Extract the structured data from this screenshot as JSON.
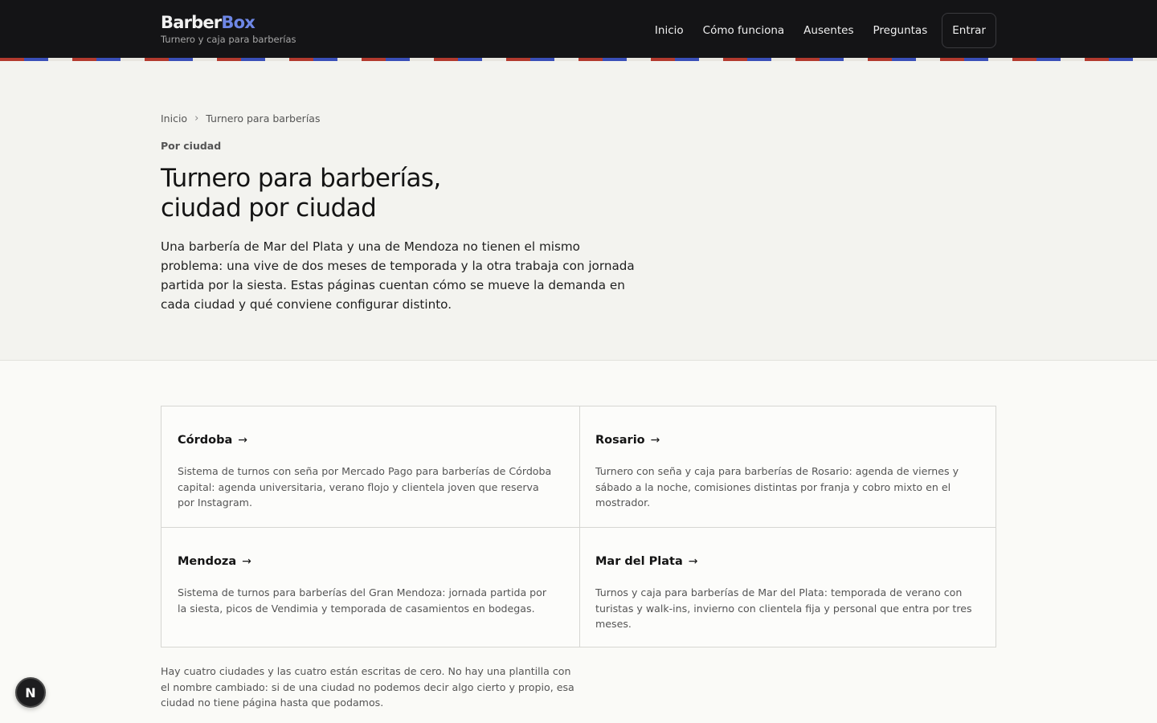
{
  "header": {
    "brand_part1": "Barber",
    "brand_part2": "Box",
    "tagline": "Turnero y caja para barberías",
    "nav": [
      "Inicio",
      "Cómo funciona",
      "Ausentes",
      "Preguntas"
    ],
    "login_label": "Entrar"
  },
  "breadcrumb": {
    "home": "Inicio",
    "separator": "›",
    "current": "Turnero para barberías"
  },
  "hero": {
    "eyebrow": "Por ciudad",
    "title_line1": "Turnero para barberías,",
    "title_line2": "ciudad por ciudad",
    "lead": "Una barbería de Mar del Plata y una de Mendoza no tienen el mismo problema: una vive de dos meses de temporada y la otra trabaja con jornada partida por la siesta. Estas páginas cuentan cómo se mueve la demanda en cada ciudad y qué conviene configurar distinto."
  },
  "cities": [
    {
      "name": "Córdoba",
      "arrow": "→",
      "description": "Sistema de turnos con seña por Mercado Pago para barberías de Córdoba capital: agenda universitaria, verano flojo y clientela joven que reserva por Instagram."
    },
    {
      "name": "Rosario",
      "arrow": "→",
      "description": "Turnero con seña y caja para barberías de Rosario: agenda de viernes y sábado a la noche, comisiones distintas por franja y cobro mixto en el mostrador."
    },
    {
      "name": "Mendoza",
      "arrow": "→",
      "description": "Sistema de turnos para barberías del Gran Mendoza: jornada partida por la siesta, picos de Vendimia y temporada de casamientos en bodegas."
    },
    {
      "name": "Mar del Plata",
      "arrow": "→",
      "description": "Turnos y caja para barberías de Mar del Plata: temporada de verano con turistas y walk-ins, invierno con clientela fija y personal que entra por tres meses."
    }
  ],
  "footnote": "Hay cuatro ciudades y las cuatro están escritas de cero. No hay una plantilla con el nombre cambiado: si de una ciudad no podemos decir algo cierto y propio, esa ciudad no tiene página hasta que podamos.",
  "fab": {
    "label": "N"
  },
  "colors": {
    "header_bg": "#141416",
    "brand_accent": "#6e87e6",
    "pole_red": "#b33a2e",
    "pole_blue": "#3a4fb8",
    "pole_white": "#e8e6e0",
    "hero_bg": "#f3f3ef"
  }
}
